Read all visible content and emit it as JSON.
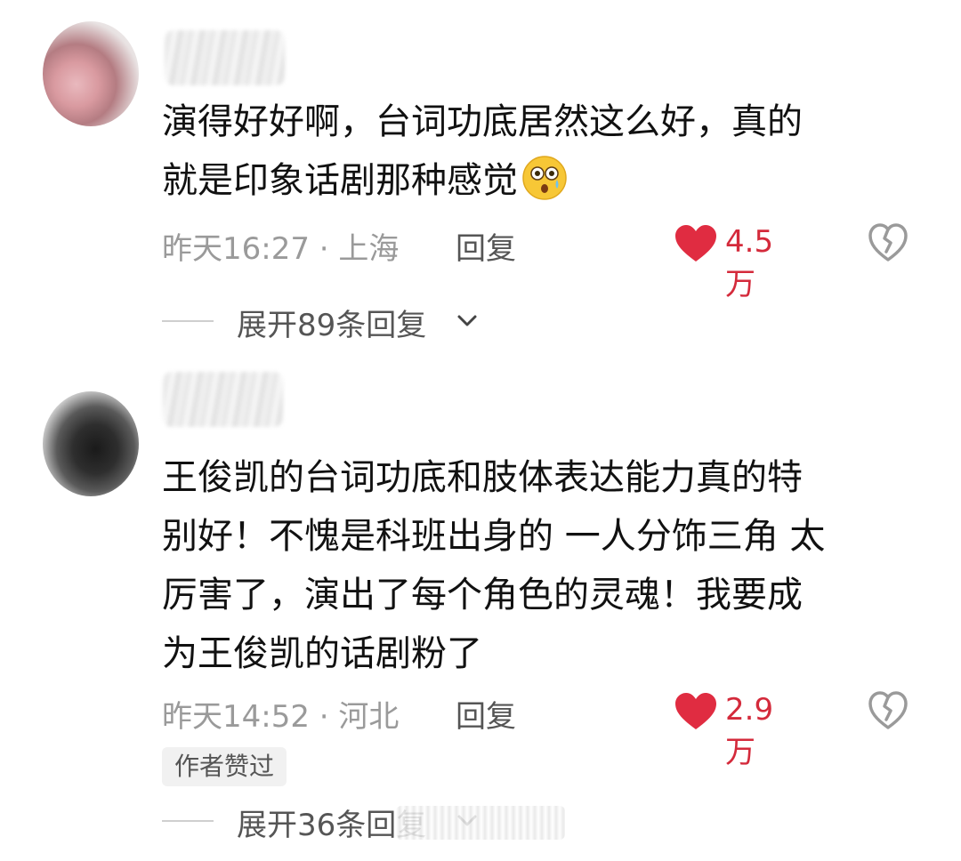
{
  "comments": [
    {
      "text": "演得好好啊，台词功底居然这么好，真的\n就是印象话剧那种感觉",
      "emoji": "flushed-face-emoji",
      "time_location": "昨天16:27 · 上海",
      "reply_label": "回复",
      "like_count": "4.5万",
      "expand_label": "展开89条回复"
    },
    {
      "text": "王俊凯的台词功底和肢体表达能力真的特\n别好！不愧是科班出身的 一人分饰三角 太\n厉害了，演出了每个角色的灵魂！我要成\n为王俊凯的话剧粉了",
      "time_location": "昨天14:52 · 河北",
      "reply_label": "回复",
      "like_count": "2.9万",
      "author_badge": "作者赞过",
      "expand_label": "展开36条回复"
    }
  ],
  "colors": {
    "like_red": "#d42a3b",
    "meta_gray": "#9a9a9a",
    "text_dark": "#111111"
  },
  "icons": {
    "like": "heart-icon",
    "dislike": "broken-heart-icon",
    "expand": "chevron-down-icon"
  }
}
